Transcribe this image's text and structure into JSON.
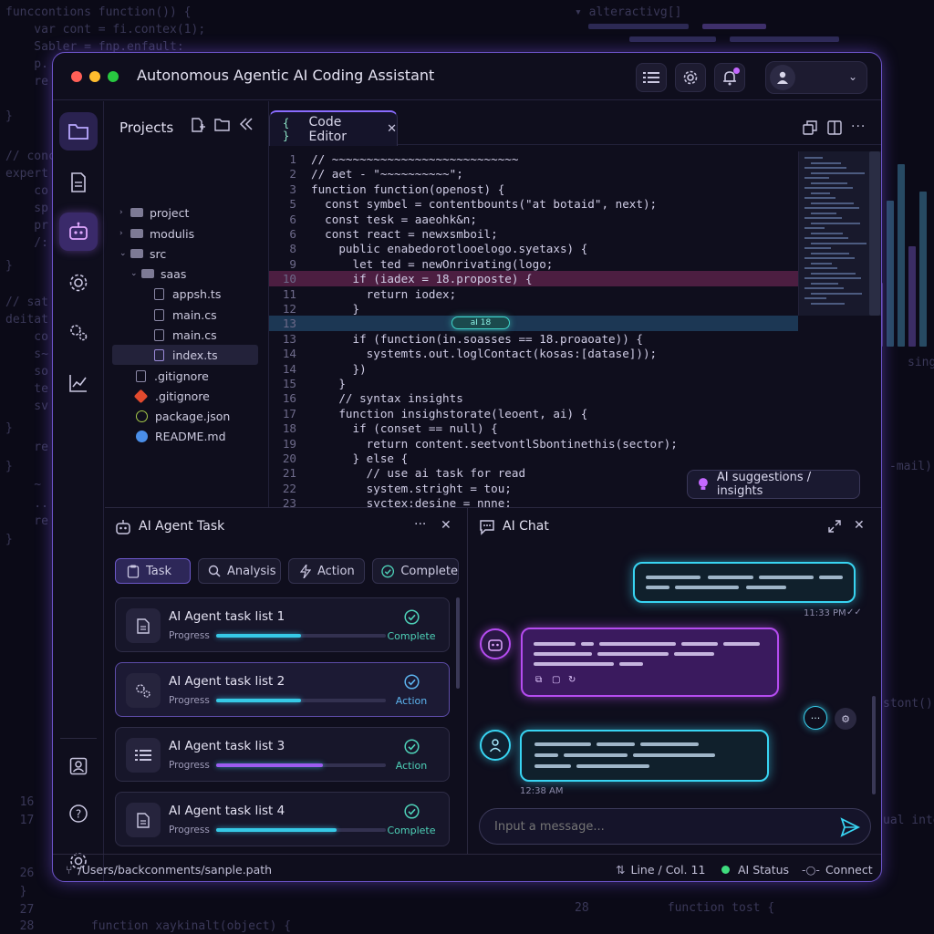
{
  "app": {
    "title": "Autonomous Agentic AI Coding Assistant"
  },
  "colors": {
    "accent_purple": "#8a6cff",
    "accent_cyan": "#38d4f2",
    "accent_magenta": "#b54cf0",
    "status_green": "#4ed1b8",
    "status_blue": "#5cb3ee"
  },
  "explorer": {
    "title": "Projects",
    "tree": [
      {
        "label": "project",
        "type": "folder",
        "expanded": false
      },
      {
        "label": "modulis",
        "type": "folder",
        "expanded": false
      },
      {
        "label": "src",
        "type": "folder",
        "expanded": true
      },
      {
        "label": "saas",
        "type": "folder",
        "expanded": true
      },
      {
        "label": "appsh.ts",
        "type": "file"
      },
      {
        "label": "main.cs",
        "type": "file"
      },
      {
        "label": "main.cs",
        "type": "file"
      },
      {
        "label": "index.ts",
        "type": "file",
        "selected": true
      },
      {
        "label": ".gitignore",
        "type": "file"
      },
      {
        "label": ".gitignore",
        "type": "file-git"
      },
      {
        "label": "package.json",
        "type": "file-json"
      },
      {
        "label": "README.md",
        "type": "file-info"
      }
    ]
  },
  "editor": {
    "tab_label": "Code Editor",
    "inline_ai_tag": "aI 18",
    "lines": [
      {
        "n": "1",
        "t": "// ~~~~~~~~~~~~~~~~~~~~~~~~~~~"
      },
      {
        "n": "2",
        "t": "// aet - \"~~~~~~~~~~\";"
      },
      {
        "n": "3",
        "t": "function function(openost) {"
      },
      {
        "n": "5",
        "t": "  const symbel = contentbounts(\"at botaid\", next);"
      },
      {
        "n": "6",
        "t": "  const tesk = aaeohk&n;"
      },
      {
        "n": "6",
        "t": "  const react = newxsmboil;"
      },
      {
        "n": "8",
        "t": "    public enabedorotlooelogo.syetaxs) {"
      },
      {
        "n": "9",
        "t": "      let ted = newOnrivating(logo;"
      },
      {
        "n": "10",
        "t": "      if (iadex = 18.proposte) {"
      },
      {
        "n": "11",
        "t": "        return iodex;"
      },
      {
        "n": "12",
        "t": "      }"
      },
      {
        "n": "13",
        "t": ""
      },
      {
        "n": "13",
        "t": "      if (function(in.soasses == 18.proaoate)) {"
      },
      {
        "n": "14",
        "t": "        systemts.out.loglContact(kosas:[datase]));"
      },
      {
        "n": "14",
        "t": "      })"
      },
      {
        "n": "15",
        "t": "    }"
      },
      {
        "n": "16",
        "t": "    // syntax insights"
      },
      {
        "n": "17",
        "t": "    function insighstorate(leoent, ai) {"
      },
      {
        "n": "18",
        "t": "      if (conset == null) {"
      },
      {
        "n": "19",
        "t": "        return content.seetvontlSbontinethis(sector);"
      },
      {
        "n": "20",
        "t": "      } else {"
      },
      {
        "n": "21",
        "t": "        // use ai task for read"
      },
      {
        "n": "22",
        "t": "        system.stright = tou;"
      },
      {
        "n": "23",
        "t": "        syctex:desine = nnne;"
      }
    ],
    "ai_suggestions_label": "AI suggestions / insights"
  },
  "task_panel": {
    "title": "AI Agent Task",
    "filters": [
      {
        "label": "Task",
        "icon": "clipboard-icon",
        "active": true
      },
      {
        "label": "Analysis",
        "icon": "search-icon",
        "active": false
      },
      {
        "label": "Action",
        "icon": "bolt-icon",
        "active": false
      },
      {
        "label": "Complete",
        "icon": "check-circle-icon",
        "active": false
      }
    ],
    "tasks": [
      {
        "name": "AI Agent task list 1",
        "progress_label": "Progress",
        "progress": 0.5,
        "status": "Complete",
        "icon": "document-icon",
        "bar_color": "#36c9e6"
      },
      {
        "name": "AI Agent task list 2",
        "progress_label": "Progress",
        "progress": 0.5,
        "status": "Action",
        "icon": "gears-icon",
        "bar_color": "#36c9e6"
      },
      {
        "name": "AI Agent task list 3",
        "progress_label": "Progress",
        "progress": 0.63,
        "status": "Action",
        "icon": "list-icon",
        "bar_color": "#9b5cf0"
      },
      {
        "name": "AI Agent task list 4",
        "progress_label": "Progress",
        "progress": 0.71,
        "status": "Complete",
        "icon": "document-icon",
        "bar_color": "#36c9e6"
      }
    ]
  },
  "chat_panel": {
    "title": "AI Chat",
    "messages": [
      {
        "from": "user",
        "time": "11:33 PM"
      },
      {
        "from": "ai",
        "time": ""
      },
      {
        "from": "user",
        "time": "12:38 AM"
      }
    ],
    "input_placeholder": "Input a message..."
  },
  "status_bar": {
    "path": "/Users/backconments/sanple.path",
    "position": "Line / Col. 11",
    "ai_status": "AI Status",
    "connect": "Connect"
  }
}
